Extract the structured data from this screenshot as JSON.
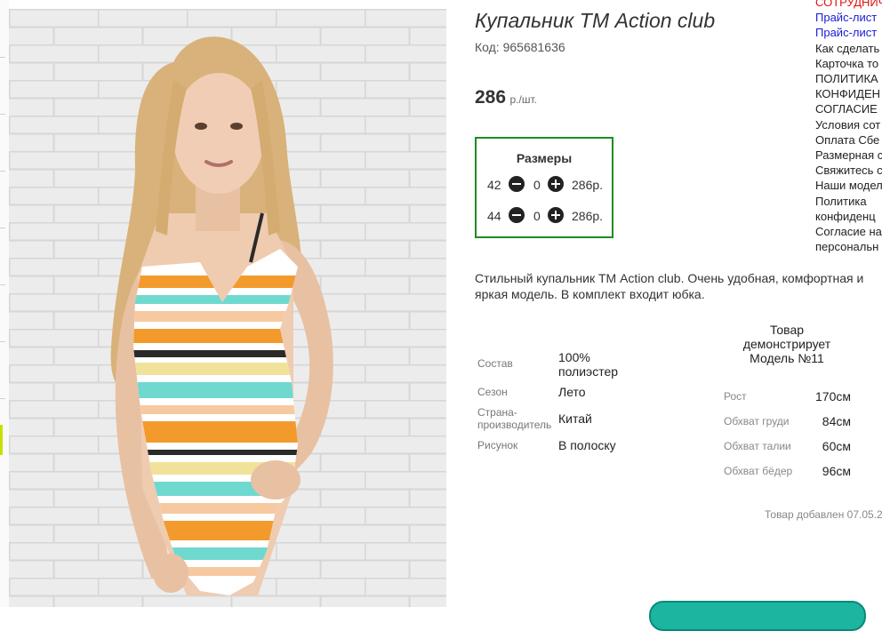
{
  "product": {
    "title": "Купальник ТМ Action club",
    "code_label": "Код:",
    "code_value": "965681636",
    "price_value": "286",
    "price_unit": "р./шт."
  },
  "sizes": {
    "title": "Размеры",
    "rows": [
      {
        "size": "42",
        "qty": "0",
        "price": "286р."
      },
      {
        "size": "44",
        "qty": "0",
        "price": "286р."
      }
    ]
  },
  "description": "Стильный купальник ТМ Action club. Очень удобная, комфортная и яркая модель. В комплект входит юбка.",
  "attributes": [
    {
      "label": "Состав",
      "value": "100% полиэстер"
    },
    {
      "label": "Сезон",
      "value": "Лето"
    },
    {
      "label": "Страна-производитель",
      "value": "Китай"
    },
    {
      "label": "Рисунок",
      "value": "В полоску"
    }
  ],
  "model": {
    "heading": "Товар демонстрирует Модель №11",
    "measurements": [
      {
        "label": "Рост",
        "value": "170см"
      },
      {
        "label": "Обхват груди",
        "value": "84см"
      },
      {
        "label": "Обхват талии",
        "value": "60см"
      },
      {
        "label": "Обхват бёдер",
        "value": "96см"
      }
    ]
  },
  "added_text": "Товар добавлен 07.05.2",
  "side_menu": [
    "СОТРУДНИЧ",
    "Прайс-лист",
    "Прайс-лист",
    "Как сделать",
    "Карточка то",
    "ПОЛИТИКА",
    "КОНФИДЕН",
    "СОГЛАСИЕ",
    "Условия сот",
    "Оплата Сбе",
    "Размерная с",
    "Свяжитесь с",
    "Наши модел",
    "Политика",
    "конфиденц",
    "Согласие на",
    "персональн"
  ],
  "colors": {
    "sizes_border": "#1f8b1f",
    "menu_red": "#e01010",
    "menu_blue": "#1a1ad8",
    "bottom_button": "#1bb5a0"
  }
}
